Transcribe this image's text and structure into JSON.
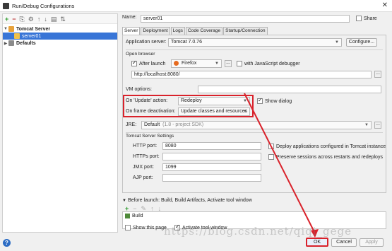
{
  "window": {
    "title": "Run/Debug Configurations",
    "close": "✕"
  },
  "toolbar": {
    "add": "+",
    "remove": "−",
    "copy": "⎘",
    "settings": "⚙",
    "up": "↑",
    "down": "↓",
    "folder": "▤",
    "sort": "⇅"
  },
  "tree": {
    "group_label": "Tomcat Server",
    "child_label": "server01",
    "defaults_label": "Defaults"
  },
  "config": {
    "name_label": "Name:",
    "name_value": "server01",
    "share_label": "Share"
  },
  "tabs": [
    "Server",
    "Deployment",
    "Logs",
    "Code Coverage",
    "Startup/Connection"
  ],
  "server": {
    "app_server_label": "Application server:",
    "app_server_value": "Tomcat 7.0.76",
    "configure_label": "Configure...",
    "open_browser_title": "Open browser",
    "after_launch_label": "After launch",
    "browser_value": "Firefox",
    "js_debugger_label": "with JavaScript debugger",
    "url_value": "http://localhost:8080/",
    "vm_options_label": "VM options:",
    "vm_options_value": "",
    "on_update_label": "On 'Update' action:",
    "on_update_value": "Redeploy",
    "show_dialog_label": "Show dialog",
    "on_frame_label": "On frame deactivation:",
    "on_frame_value": "Update classes and resources",
    "jre_label": "JRE:",
    "jre_value": "Default",
    "jre_hint": "(1.8 - project SDK)",
    "tomcat_settings_title": "Tomcat Server Settings",
    "http_port_label": "HTTP port:",
    "http_port_value": "8080",
    "https_port_label": "HTTPs port:",
    "https_port_value": "",
    "jmx_port_label": "JMX port:",
    "jmx_port_value": "1099",
    "ajp_port_label": "AJP port:",
    "ajp_port_value": "",
    "deploy_apps_label": "Deploy applications configured in Tomcat instance",
    "preserve_sessions_label": "Preserve sessions across restarts and redeploys"
  },
  "before_launch": {
    "title": "Before launch: Build, Build Artifacts, Activate tool window",
    "item": "Build",
    "show_page_label": "Show this page",
    "activate_label": "Activate tool window"
  },
  "buttons": {
    "ok": "OK",
    "cancel": "Cancel",
    "apply": "Apply",
    "help": "?"
  },
  "watermark": "https://blog.csdn.net/qiqi_gege",
  "colors": {
    "selection": "#3875d7",
    "annotation": "#d9222b",
    "help": "#2c6cc4"
  }
}
